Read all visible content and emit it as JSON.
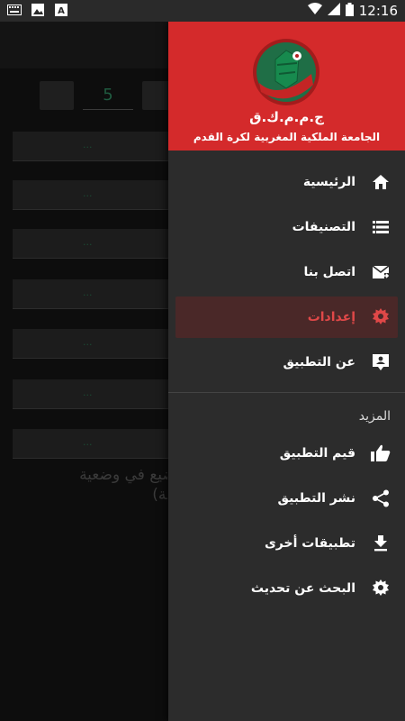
{
  "status_bar": {
    "time": "12:16",
    "notif_icons": [
      "keyboard-icon",
      "image-icon",
      "a-letter-icon"
    ],
    "sys_icons": [
      "wifi-icon",
      "signal-icon",
      "battery-icon"
    ]
  },
  "background": {
    "stepper_value": "5",
    "row_labels": [
      "...",
      "...",
      "...",
      "...",
      "...",
      "...",
      "..."
    ],
    "text_line1": "ن المواضيع في وضعية",
    "text_line2": "ة (تجريبية)"
  },
  "drawer": {
    "brand": "ج.م.م.ك.ق",
    "full_name": "الجامعة الملكية المغربية لكرة القدم",
    "items": [
      {
        "label": "الرئيسية",
        "icon": "home-icon"
      },
      {
        "label": "التصنيفات",
        "icon": "list-icon"
      },
      {
        "label": "اتصل بنا",
        "icon": "mail-forward-icon"
      },
      {
        "label": "إعدادات",
        "icon": "gear-icon",
        "active": true
      },
      {
        "label": "عن التطبيق",
        "icon": "person-chat-icon"
      }
    ],
    "section_title": "المزيد",
    "more_items": [
      {
        "label": "قيم التطبيق",
        "icon": "thumbs-up-icon"
      },
      {
        "label": "نشر التطبيق",
        "icon": "share-icon"
      },
      {
        "label": "تطبيقات أخرى",
        "icon": "download-icon"
      },
      {
        "label": "البحث عن تحديث",
        "icon": "gear-icon"
      }
    ]
  },
  "colors": {
    "header_red": "#d42a2b",
    "drawer_bg": "#2c2c2c",
    "active_bg": "#4a2828",
    "active_text": "#e04848"
  }
}
